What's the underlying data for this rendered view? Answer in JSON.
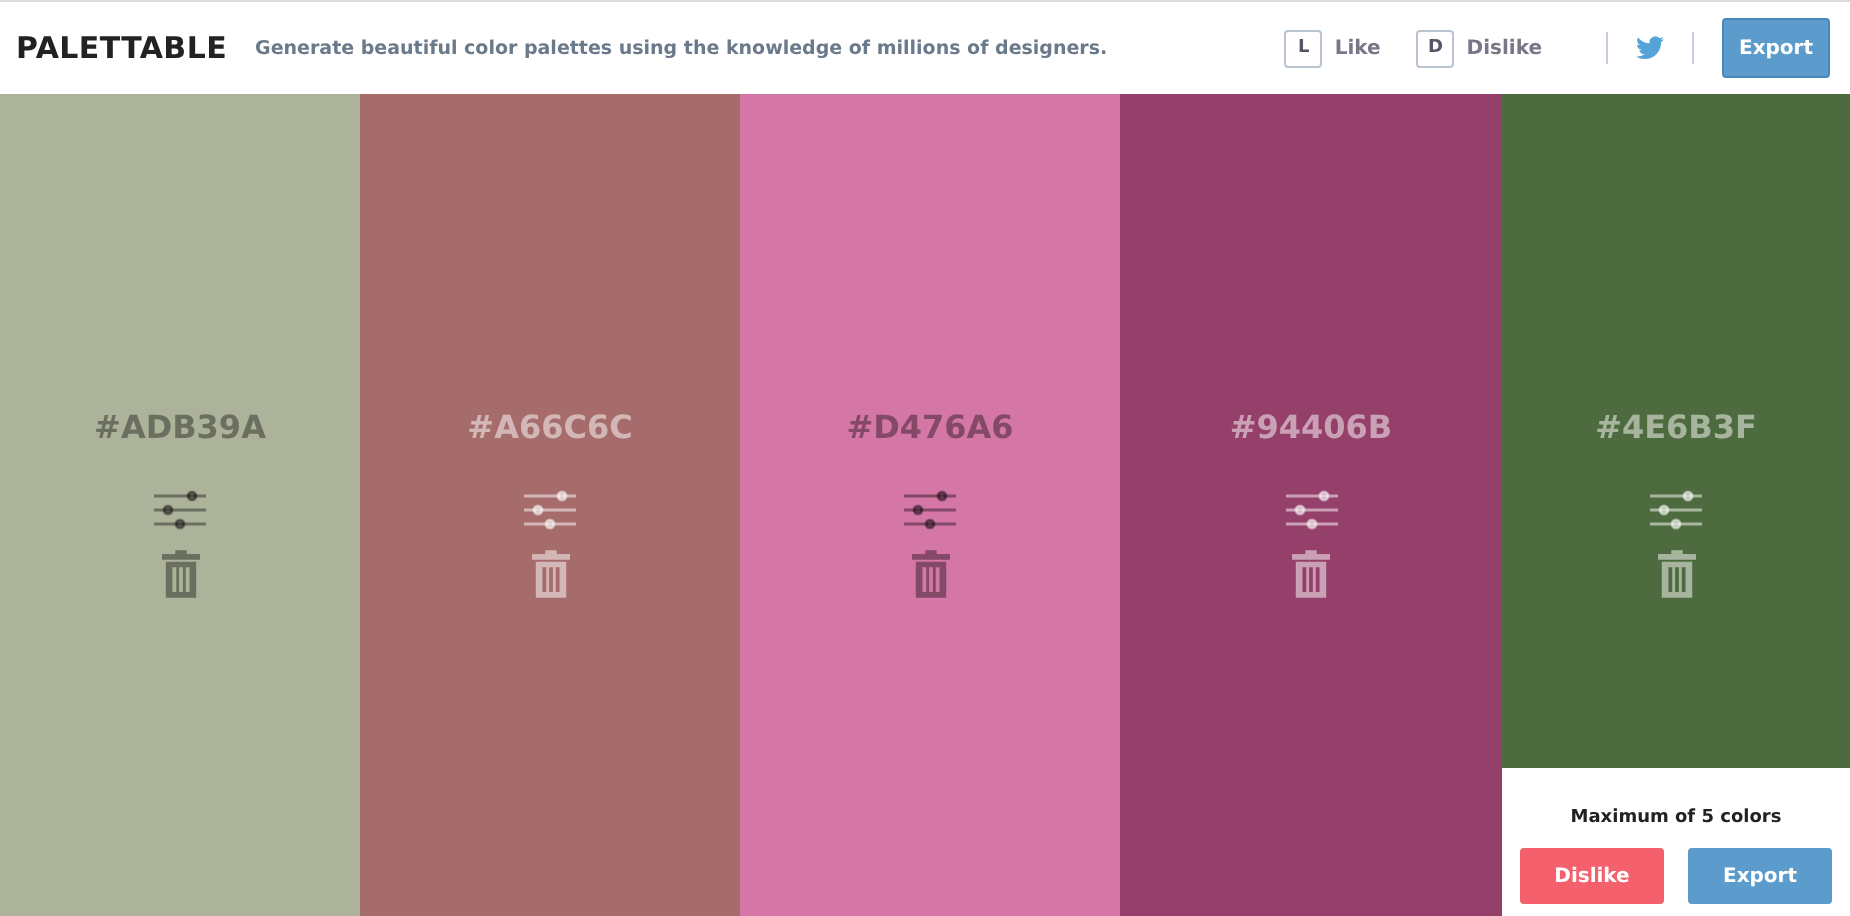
{
  "header": {
    "logo": "PALETTABLE",
    "tagline": "Generate beautiful color palettes using the knowledge of millions of designers.",
    "actions": [
      {
        "key": "L",
        "label": "Like"
      },
      {
        "key": "D",
        "label": "Dislike"
      }
    ],
    "export": "Export"
  },
  "swatches": [
    {
      "hex": "#ADB39A",
      "color": "#adb39a",
      "kind": "dark"
    },
    {
      "hex": "#A66C6C",
      "color": "#a66c6c",
      "kind": "light"
    },
    {
      "hex": "#D476A6",
      "color": "#d476a6",
      "kind": "dark"
    },
    {
      "hex": "#94406B",
      "color": "#94406b",
      "kind": "light"
    },
    {
      "hex": "#4E6B3F",
      "color": "#4e6b3f",
      "kind": "light"
    }
  ],
  "panel": {
    "message": "Maximum of 5 colors",
    "dislike": "Dislike",
    "export": "Export"
  }
}
